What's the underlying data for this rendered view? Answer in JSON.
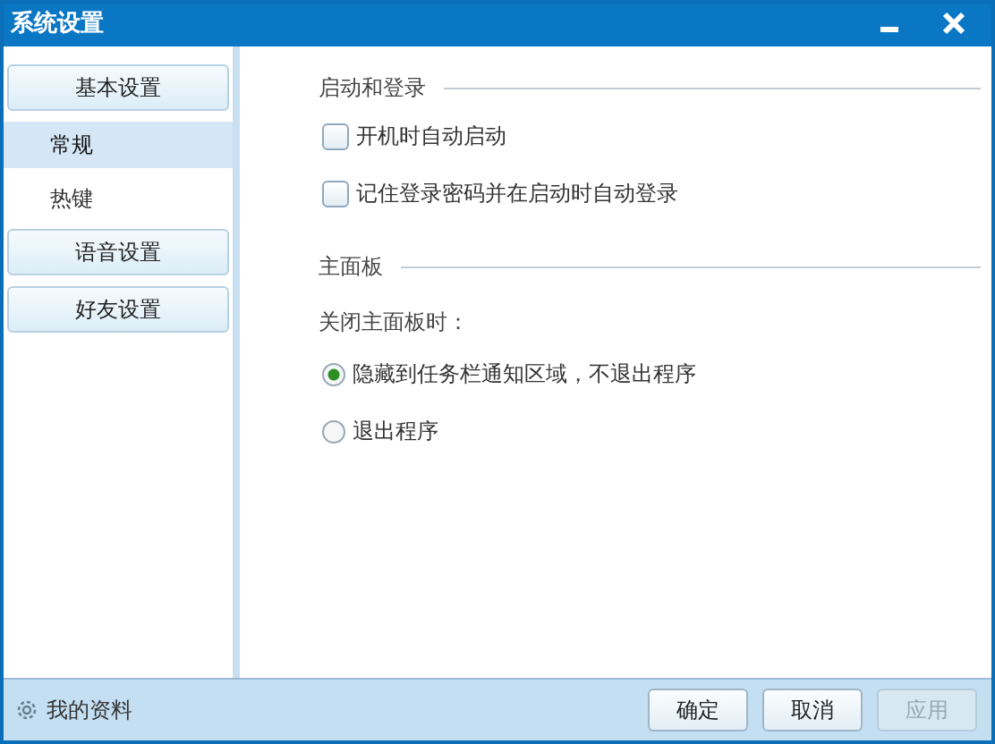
{
  "window": {
    "title": "系统设置"
  },
  "sidebar": {
    "groups": [
      {
        "label": "基本设置",
        "children": [
          {
            "label": "常规",
            "selected": true
          },
          {
            "label": "热键",
            "selected": false
          }
        ]
      },
      {
        "label": "语音设置"
      },
      {
        "label": "好友设置"
      }
    ]
  },
  "sections": [
    {
      "title": "启动和登录",
      "items": [
        {
          "kind": "checkbox",
          "label": "开机时自动启动",
          "checked": false
        },
        {
          "kind": "checkbox",
          "label": "记住登录密码并在启动时自动登录",
          "checked": false
        }
      ]
    },
    {
      "title": "主面板",
      "prompt": "关闭主面板时：",
      "items": [
        {
          "kind": "radio",
          "label": "隐藏到任务栏通知区域，不退出程序",
          "selected": true
        },
        {
          "kind": "radio",
          "label": "退出程序",
          "selected": false
        }
      ]
    }
  ],
  "footer": {
    "link": "我的资料",
    "buttons": [
      {
        "label": "确定",
        "disabled": false
      },
      {
        "label": "取消",
        "disabled": false
      },
      {
        "label": "应用",
        "disabled": true
      }
    ]
  }
}
